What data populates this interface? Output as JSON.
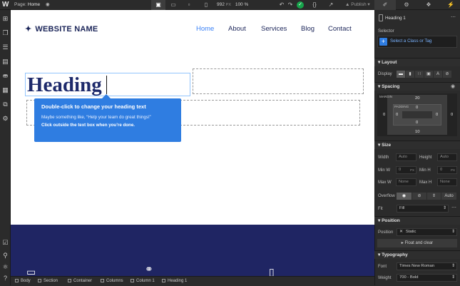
{
  "topbar": {
    "page_label": "Page:",
    "page_name": "Home",
    "px_value": "992",
    "px_unit": "PX",
    "zoom": "100 %",
    "publish": "Publish"
  },
  "canvas": {
    "site_name": "WEBSITE NAME",
    "nav": [
      "Home",
      "About",
      "Services",
      "Blog",
      "Contact"
    ],
    "heading": "Heading",
    "tooltip": {
      "title": "Double-click to change your heading text",
      "body": "Maybe something like, “Help your team do great things!”",
      "footer": "Click outside the text box when you’re done."
    }
  },
  "breadcrumb": [
    "Body",
    "Section",
    "Container",
    "Columns",
    "Column 1",
    "Heading 1"
  ],
  "panel": {
    "element_name": "Heading 1",
    "selector_label": "Selector",
    "selector_placeholder": "Select a Class or Tag",
    "layout": {
      "title": "Layout",
      "display_label": "Display"
    },
    "spacing": {
      "title": "Spacing",
      "margin_label": "MARGIN",
      "padding_label": "PADDING",
      "margin_top": "20",
      "margin_bottom": "10",
      "margin_left": "0",
      "margin_right": "0",
      "padding_top": "0",
      "padding_bottom": "0",
      "padding_left": "0",
      "padding_right": "0",
      "content": "0"
    },
    "size": {
      "title": "Size",
      "width_label": "Width",
      "width_value": "Auto",
      "height_label": "Height",
      "height_value": "Auto",
      "minw_label": "Min W",
      "minw_value": "0",
      "minw_unit": "PX",
      "minh_label": "Min H",
      "minh_value": "0",
      "minh_unit": "PX",
      "maxw_label": "Max W",
      "maxw_value": "None",
      "maxh_label": "Max H",
      "maxh_value": "None",
      "overflow_label": "Overflow",
      "overflow_auto": "Auto",
      "fit_label": "Fit",
      "fit_value": "Fill"
    },
    "position": {
      "title": "Position",
      "position_label": "Position",
      "position_value": "Static",
      "float_clear": "Float and clear"
    },
    "typography": {
      "title": "Typography",
      "font_label": "Font",
      "font_value": "Times New Roman",
      "weight_label": "Weight",
      "weight_value": "700 - Bold"
    }
  },
  "colors": {
    "accent": "#2f7de1",
    "navy": "#1b2559",
    "hero_bg": "#1f2563",
    "nav_active": "#3b82f6",
    "success": "#16a34a"
  }
}
